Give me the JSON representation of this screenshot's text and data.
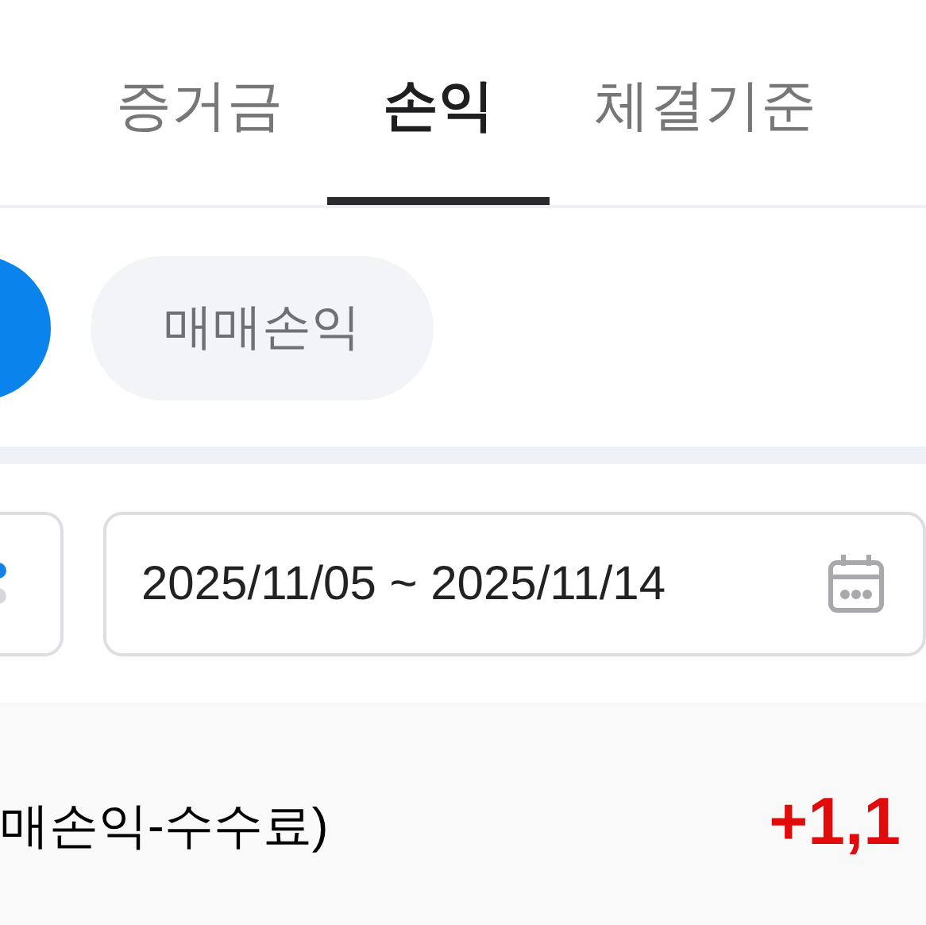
{
  "tabs": [
    {
      "label": "증거금",
      "selected": false
    },
    {
      "label": "손익",
      "selected": true
    },
    {
      "label": "체결기준",
      "selected": false
    }
  ],
  "chips": [
    {
      "selected": true
    },
    {
      "label": "매매손익",
      "selected": false
    }
  ],
  "date_range": {
    "value": "2025/11/05 ~ 2025/11/14"
  },
  "summary": {
    "label": "매손익-수수료)",
    "value": "+1,1"
  }
}
